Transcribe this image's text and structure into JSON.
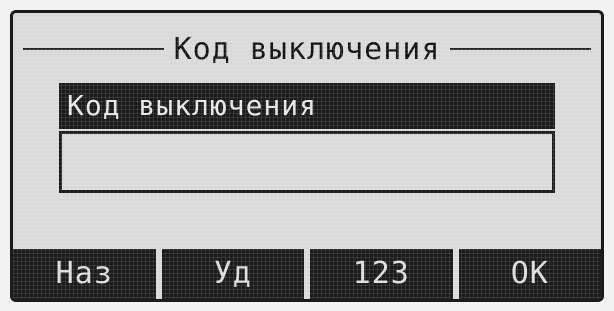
{
  "screen": {
    "title": "Код выключения"
  },
  "field": {
    "label": "Код выключения",
    "value": ""
  },
  "softkeys": [
    {
      "label": "Наз"
    },
    {
      "label": "Уд"
    },
    {
      "label": "123"
    },
    {
      "label": "ОК"
    }
  ],
  "colors": {
    "lcd_background": "#d9d9d9",
    "lcd_dark": "#1b1b1b",
    "lcd_light_text": "#e6e6e6"
  }
}
